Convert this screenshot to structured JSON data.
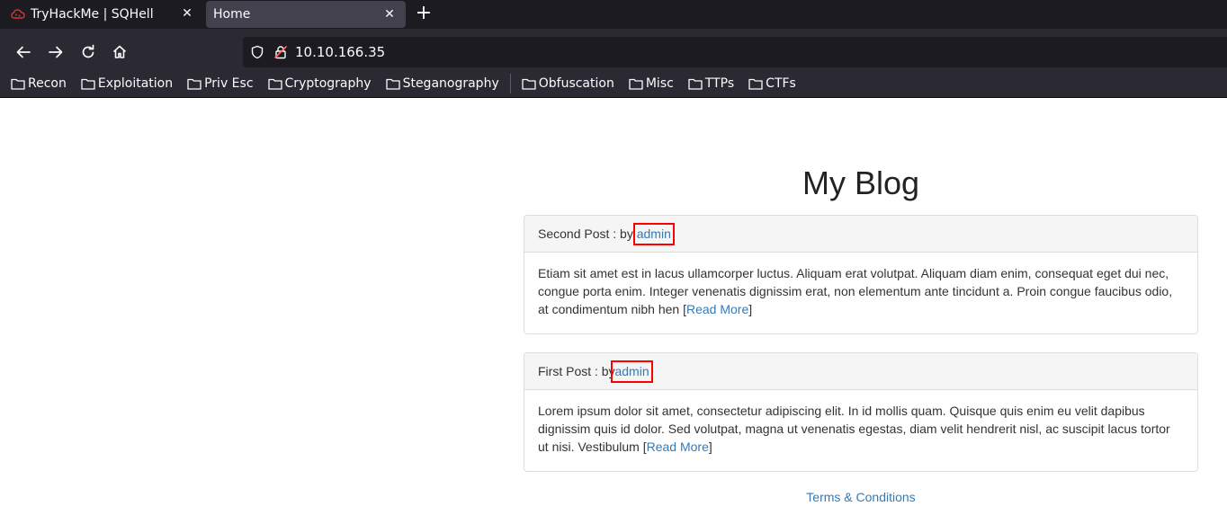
{
  "browser": {
    "tabs": [
      {
        "title": "TryHackMe | SQHell",
        "active": false,
        "favicon": "tryhackme-cloud-icon"
      },
      {
        "title": "Home",
        "active": true
      }
    ],
    "url": "10.10.166.35",
    "bookmarks": [
      "Recon",
      "Exploitation",
      "Priv Esc",
      "Cryptography",
      "Steganography",
      "Obfuscation",
      "Misc",
      "TTPs",
      "CTFs"
    ],
    "colors": {
      "chrome": "#2b2a33",
      "tabbar": "#1c1b22",
      "active_tab": "#42414d",
      "urlbar": "#1c1b22"
    }
  },
  "page": {
    "title": "My Blog",
    "posts": [
      {
        "heading_prefix": "Second Post : by ",
        "author": "admin",
        "body": "Etiam sit amet est in lacus ullamcorper luctus. Aliquam erat volutpat. Aliquam diam enim, consequat eget dui nec, congue porta enim. Integer venenatis dignissim erat, non elementum ante tincidunt a. Proin congue faucibus odio, at condimentum nibh hen ",
        "read_more": "Read More"
      },
      {
        "heading_prefix": "First Post : by ",
        "author": "admin",
        "body": "Lorem ipsum dolor sit amet, consectetur adipiscing elit. In id mollis quam. Quisque quis enim eu velit dapibus dignissim quis id dolor. Sed volutpat, magna ut venenatis egestas, diam velit hendrerit nisl, ac suscipit lacus tortor ut nisi. Vestibulum ",
        "read_more": "Read More"
      }
    ],
    "footer_link": "Terms & Conditions",
    "colors": {
      "link": "#337ab7",
      "highlight_box": "#ff0000",
      "panel_heading": "#f5f5f5"
    }
  }
}
